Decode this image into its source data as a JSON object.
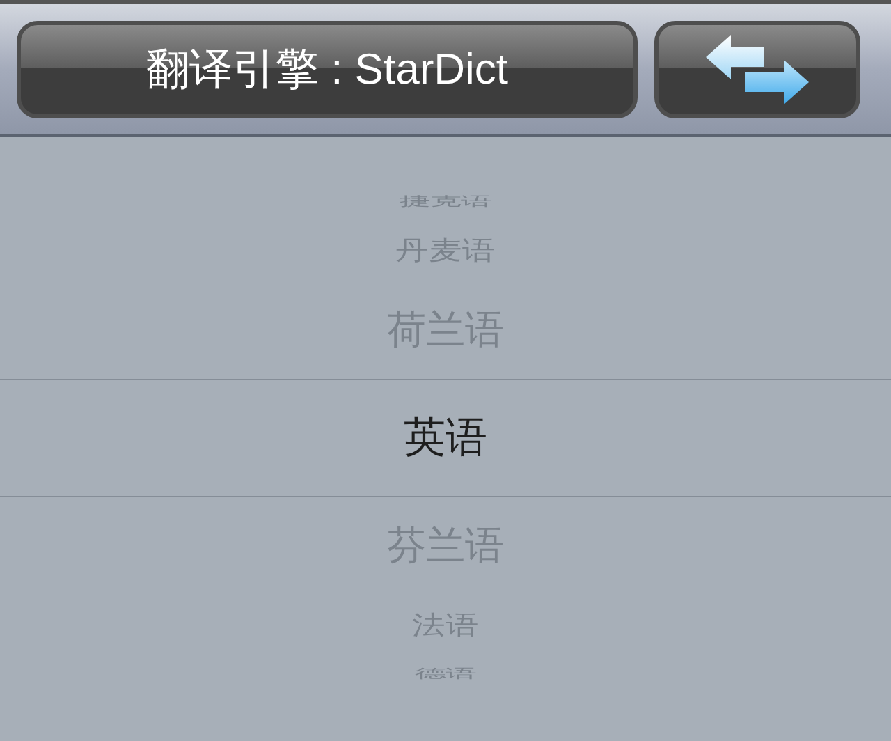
{
  "toolbar": {
    "engine_button": {
      "label": "翻译引擎 : StarDict"
    }
  },
  "language_picker": {
    "items": [
      {
        "label": "捷克语",
        "selected": false
      },
      {
        "label": "丹麦语",
        "selected": false
      },
      {
        "label": "荷兰语",
        "selected": false
      },
      {
        "label": "英语",
        "selected": true
      },
      {
        "label": "芬兰语",
        "selected": false
      },
      {
        "label": "法语",
        "selected": false
      },
      {
        "label": "德语",
        "selected": false
      }
    ]
  }
}
